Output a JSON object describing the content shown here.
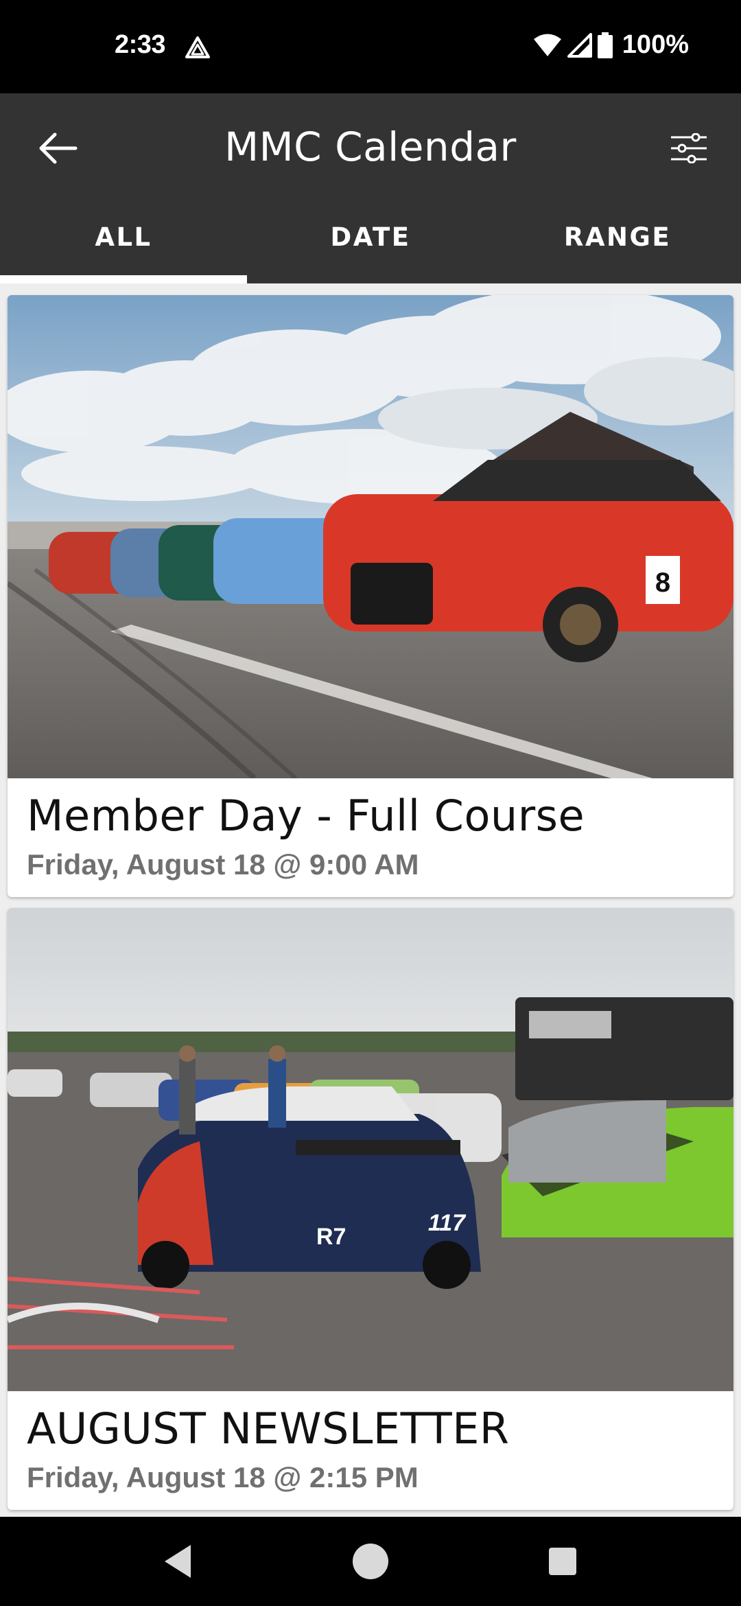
{
  "status_bar": {
    "time": "2:33",
    "battery": "100%",
    "icons": [
      "alert-triangle-icon",
      "wifi-icon",
      "signal-icon",
      "battery-icon"
    ]
  },
  "app_bar": {
    "title": "MMC Calendar",
    "back_icon": "arrow-left-icon",
    "filter_icon": "sliders-icon"
  },
  "tabs": [
    {
      "label": "ALL",
      "active": true
    },
    {
      "label": "DATE",
      "active": false
    },
    {
      "label": "RANGE",
      "active": false
    }
  ],
  "events": [
    {
      "title": "Member Day - Full Course",
      "date": "Friday, August 18 @ 9:00 AM",
      "image": "row-of-bmw-cars-on-track-photo",
      "badge": "8"
    },
    {
      "title": "AUGUST NEWSLETTER",
      "date": "Friday, August 18 @ 2:15 PM",
      "image": "race-cars-in-paddock-photo",
      "badge": "117"
    }
  ],
  "nav_bar": {
    "icons": [
      "nav-back-icon",
      "nav-home-icon",
      "nav-recents-icon"
    ]
  }
}
